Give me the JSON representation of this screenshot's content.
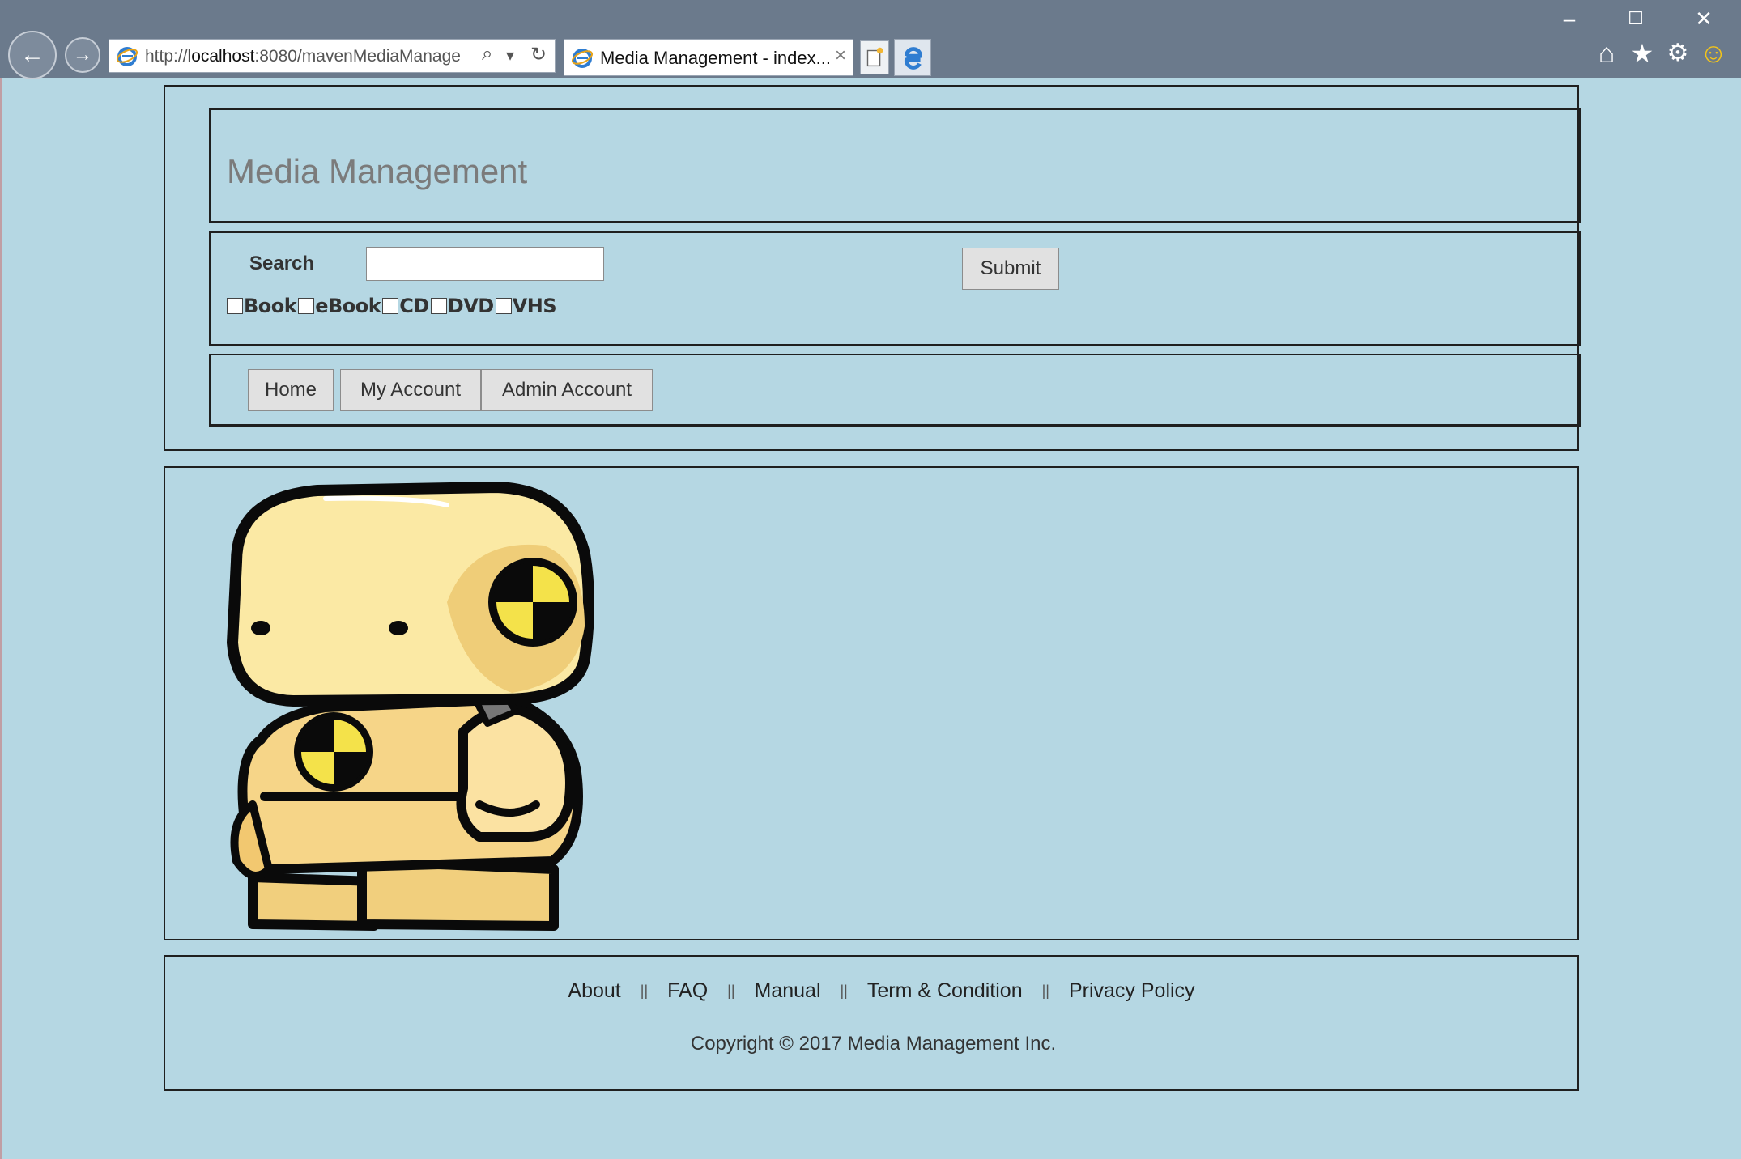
{
  "browser": {
    "address_scheme": "http://",
    "address_host": "localhost",
    "address_rest": ":8080/mavenMediaManage",
    "tab_title": "Media Management - index...",
    "tab_close": "×",
    "search_glyph": "⌕",
    "dropdown_glyph": "▾",
    "refresh_glyph": "↻",
    "back_glyph": "←",
    "forward_glyph": "→",
    "minimize_glyph": "–",
    "maximize_glyph": "☐",
    "close_glyph": "✕",
    "home_glyph": "⌂",
    "favorites_glyph": "★",
    "settings_glyph": "⚙",
    "smiley_glyph": "☺"
  },
  "header": {
    "title": "Media Management"
  },
  "search": {
    "label": "Search",
    "value": "",
    "submit_label": "Submit",
    "filters": [
      "Book",
      "eBook",
      "CD",
      "DVD",
      "VHS"
    ]
  },
  "nav": {
    "home": "Home",
    "my_account": "My Account",
    "admin_account": "Admin Account"
  },
  "footer": {
    "links": [
      "About",
      "FAQ",
      "Manual",
      "Term & Condition",
      "Privacy Policy"
    ],
    "separator": "||",
    "copyright": "Copyright © 2017 Media Management Inc."
  },
  "colors": {
    "page_bg": "#b5d7e3",
    "chrome_bg": "#6b7a8c",
    "border": "#1f1f1f"
  }
}
